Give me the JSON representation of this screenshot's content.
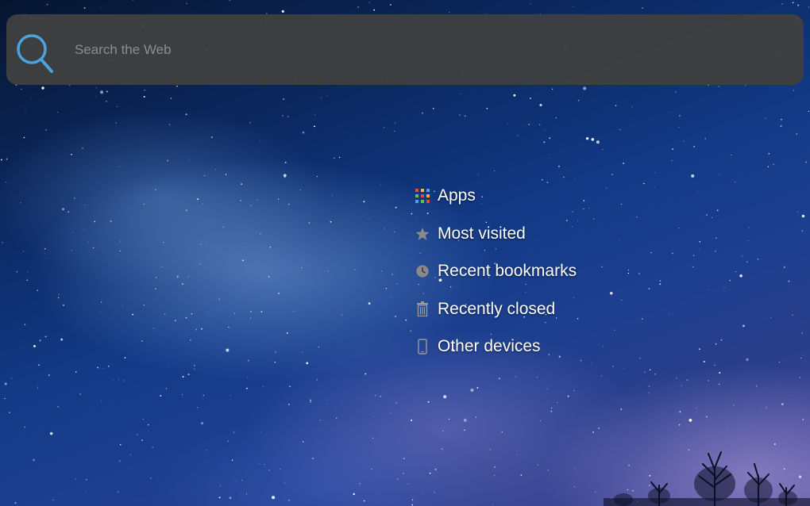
{
  "search": {
    "placeholder": "Search the Web",
    "value": "",
    "icon": "search-icon",
    "icon_color": "#4aa3df"
  },
  "menu": {
    "items": [
      {
        "id": "apps",
        "label": "Apps",
        "icon": "apps-grid-icon"
      },
      {
        "id": "most-visited",
        "label": "Most visited",
        "icon": "star-icon"
      },
      {
        "id": "recent-bookmarks",
        "label": "Recent bookmarks",
        "icon": "clock-icon"
      },
      {
        "id": "recently-closed",
        "label": "Recently closed",
        "icon": "trash-icon"
      },
      {
        "id": "other-devices",
        "label": "Other devices",
        "icon": "mobile-device-icon"
      }
    ]
  },
  "colors": {
    "search_bar_bg": "#404040",
    "menu_text": "#ffffff",
    "sky_dark": "#061630",
    "sky_mid": "#123a86"
  }
}
